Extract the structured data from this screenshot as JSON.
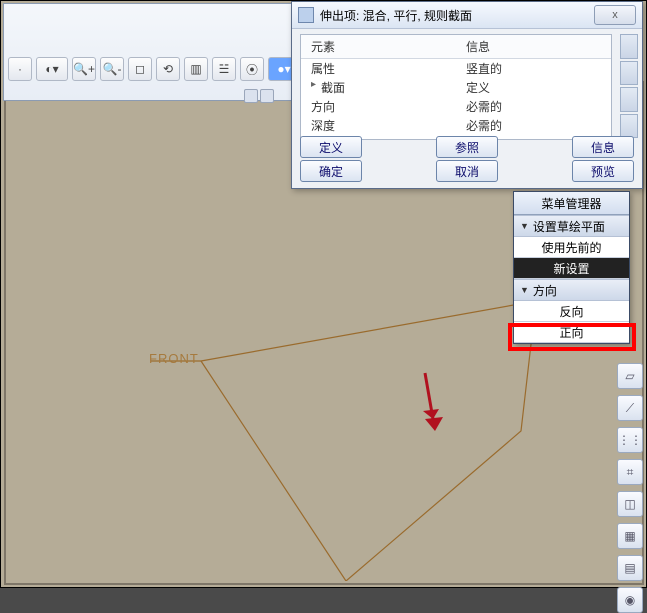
{
  "dialog": {
    "title": "伸出项: 混合, 平行, 规则截面",
    "close_label": "x",
    "columns": {
      "c1": "元素",
      "c2": "信息"
    },
    "rows": [
      {
        "elem": "属性",
        "info": "竖直的"
      },
      {
        "elem": "截面",
        "info": "定义"
      },
      {
        "elem": "方向",
        "info": "必需的"
      },
      {
        "elem": "深度",
        "info": "必需的"
      }
    ],
    "buttons": {
      "define": "定义",
      "ok": "确定",
      "ref": "参照",
      "cancel": "取消",
      "info": "信息",
      "preview": "预览"
    }
  },
  "menu_panel": {
    "title": "菜单管理器",
    "section1": "设置草绘平面",
    "item_prev": "使用先前的",
    "item_new": "新设置",
    "section2": "方向",
    "item_reverse": "反向",
    "item_forward": "正向"
  },
  "viewport": {
    "front_label": "FRONT"
  },
  "toolbar": {
    "icons": [
      "zoom-plus",
      "zoom-minus",
      "zoom-fit",
      "refit",
      "view-manager",
      "layers",
      "spin",
      "appearance"
    ]
  },
  "rail": {
    "icons": [
      "datum-plane",
      "datum-axis",
      "csys",
      "mirror",
      "section",
      "shade",
      "grid",
      "spin-center"
    ]
  }
}
